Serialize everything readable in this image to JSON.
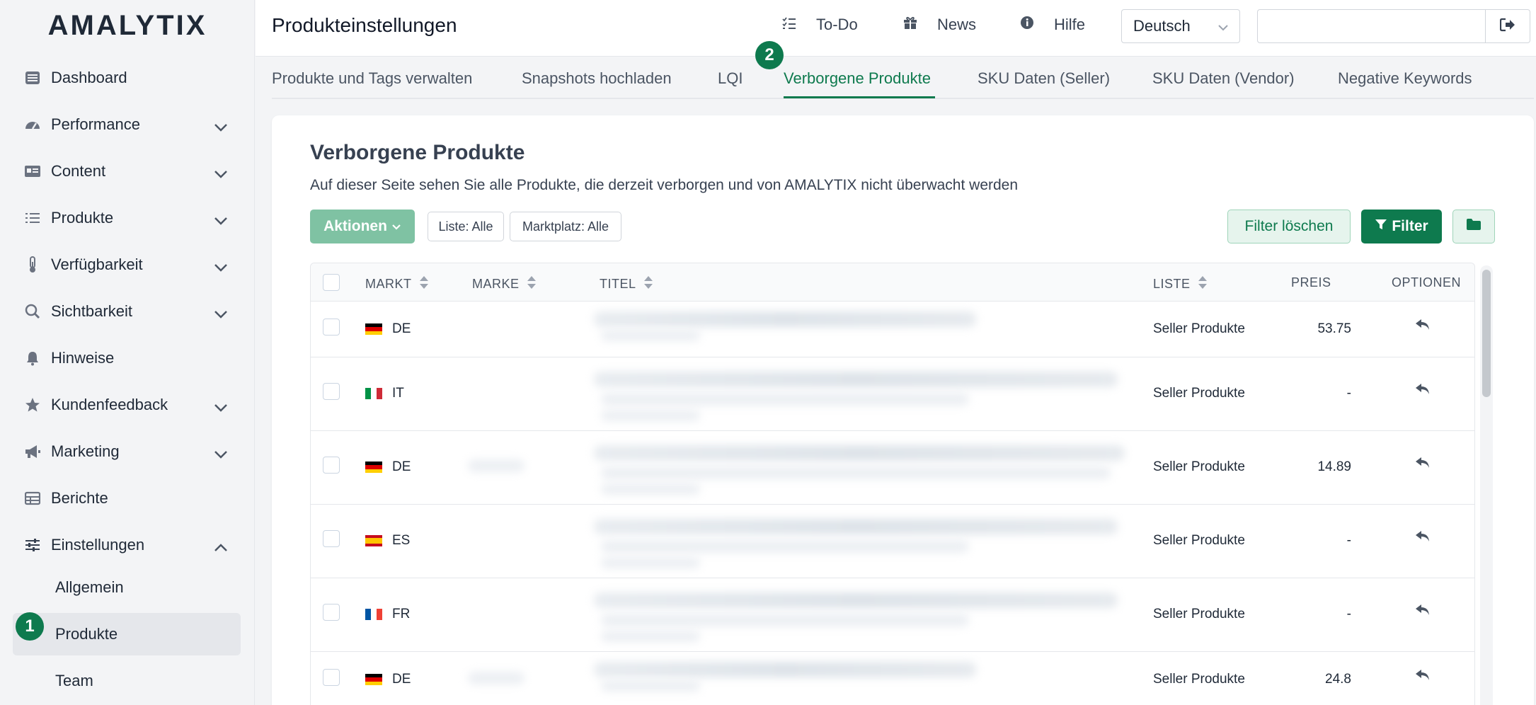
{
  "app": {
    "logo": "AMALYTIX",
    "page_title": "Produkteinstellungen"
  },
  "header": {
    "todo": "To-Do",
    "news": "News",
    "help": "Hilfe",
    "language": "Deutsch",
    "search_value": ""
  },
  "sidebar": {
    "items": [
      {
        "label": "Dashboard",
        "icon": "dashboard-icon",
        "expandable": false
      },
      {
        "label": "Performance",
        "icon": "gauge-icon",
        "expandable": true
      },
      {
        "label": "Content",
        "icon": "content-card-icon",
        "expandable": true
      },
      {
        "label": "Produkte",
        "icon": "list-icon",
        "expandable": true
      },
      {
        "label": "Verfügbarkeit",
        "icon": "thermometer-icon",
        "expandable": true
      },
      {
        "label": "Sichtbarkeit",
        "icon": "search-icon",
        "expandable": true
      },
      {
        "label": "Hinweise",
        "icon": "bell-icon",
        "expandable": false
      },
      {
        "label": "Kundenfeedback",
        "icon": "star-icon",
        "expandable": true
      },
      {
        "label": "Marketing",
        "icon": "megaphone-icon",
        "expandable": true
      },
      {
        "label": "Berichte",
        "icon": "table-icon",
        "expandable": false
      },
      {
        "label": "Einstellungen",
        "icon": "sliders-icon",
        "expandable": true,
        "expanded": true
      }
    ],
    "subitems": [
      {
        "label": "Allgemein"
      },
      {
        "label": "Produkte",
        "active": true
      },
      {
        "label": "Team"
      }
    ],
    "step_badge": "1"
  },
  "tabs": {
    "items": [
      "Produkte und Tags verwalten",
      "Snapshots hochladen",
      "LQI",
      "Verborgene Produkte",
      "SKU Daten (Seller)",
      "SKU Daten (Vendor)",
      "Negative Keywords"
    ],
    "active_index": 3,
    "step_badge": "2"
  },
  "main": {
    "title": "Verborgene Produkte",
    "description": "Auf dieser Seite sehen Sie alle Produkte, die derzeit verborgen und von AMALYTIX nicht überwacht werden",
    "actions_label": "Aktionen",
    "filter_list": "Liste: Alle",
    "filter_market": "Marktplatz: Alle",
    "clear_filter_label": "Filter löschen",
    "filter_label": "Filter"
  },
  "table": {
    "headers": {
      "market": "MARKT",
      "brand": "MARKE",
      "title": "TITEL",
      "list": "LISTE",
      "price": "PREIS",
      "options": "OPTIONEN"
    },
    "rows": [
      {
        "market": "DE",
        "list": "Seller Produkte",
        "price": "53.75"
      },
      {
        "market": "IT",
        "list": "Seller Produkte",
        "price": "-"
      },
      {
        "market": "DE",
        "list": "Seller Produkte",
        "price": "14.89"
      },
      {
        "market": "ES",
        "list": "Seller Produkte",
        "price": "-"
      },
      {
        "market": "FR",
        "list": "Seller Produkte",
        "price": "-"
      },
      {
        "market": "DE",
        "list": "Seller Produkte",
        "price": "24.8"
      }
    ]
  },
  "colors": {
    "accent": "#0e7a4e",
    "accent_light": "#7fc2a3"
  }
}
